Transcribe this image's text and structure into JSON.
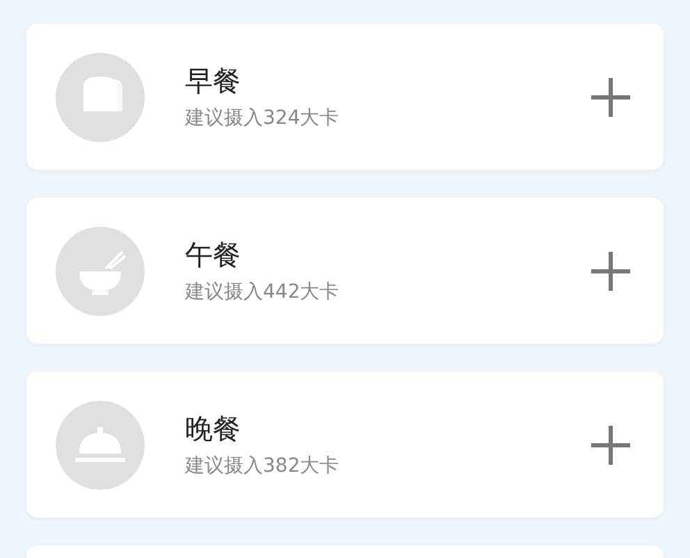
{
  "meals": [
    {
      "kind": "bread",
      "title": "早餐",
      "hint": "建议摄入324大卡"
    },
    {
      "kind": "bowl",
      "title": "午餐",
      "hint": "建议摄入442大卡"
    },
    {
      "kind": "cloche",
      "title": "晚餐",
      "hint": "建议摄入382大卡"
    }
  ]
}
